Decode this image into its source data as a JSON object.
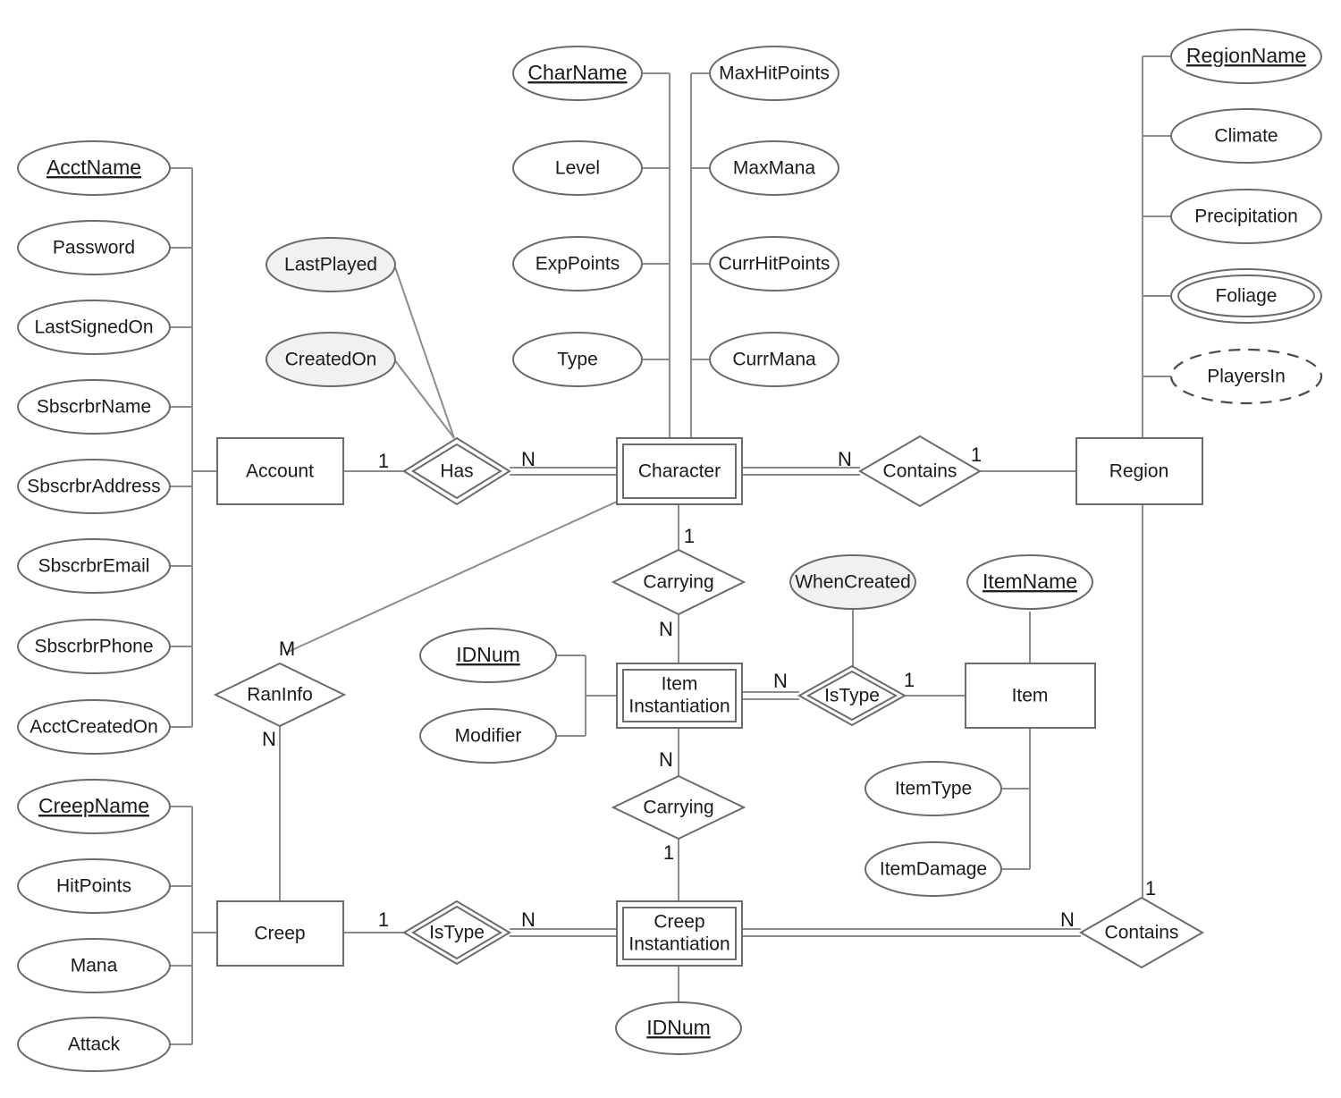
{
  "diagram": {
    "title": "ER Diagram",
    "colors": {
      "stroke": "#6b6b6b",
      "link": "#8c8c8c",
      "shaded_fill": "#f1f1f1",
      "plain_fill": "#ffffff",
      "text": "#1b1b1b"
    },
    "entities": [
      {
        "id": "account",
        "label": "Account",
        "kind": "strong"
      },
      {
        "id": "character",
        "label": "Character",
        "kind": "weak"
      },
      {
        "id": "region",
        "label": "Region",
        "kind": "strong"
      },
      {
        "id": "item_inst",
        "label_line1": "Item",
        "label_line2": "Instantiation",
        "kind": "weak"
      },
      {
        "id": "item",
        "label": "Item",
        "kind": "strong"
      },
      {
        "id": "creep",
        "label": "Creep",
        "kind": "strong"
      },
      {
        "id": "creep_inst",
        "label_line1": "Creep",
        "label_line2": "Instantiation",
        "kind": "weak"
      }
    ],
    "relationships": [
      {
        "id": "has",
        "label": "Has",
        "kind": "identifying",
        "left_card": "1",
        "right_card": "N"
      },
      {
        "id": "contains_top",
        "label": "Contains",
        "kind": "normal",
        "left_card": "N",
        "right_card": "1"
      },
      {
        "id": "carrying_char_item",
        "label": "Carrying",
        "kind": "normal",
        "top_card": "1",
        "bottom_card": "N"
      },
      {
        "id": "istype_item",
        "label": "IsType",
        "kind": "identifying",
        "left_card": "N",
        "right_card": "1"
      },
      {
        "id": "raninfo",
        "label": "RanInfo",
        "kind": "normal",
        "top_card": "M",
        "bottom_card": "N"
      },
      {
        "id": "carrying_item_creep",
        "label": "Carrying",
        "kind": "normal",
        "top_card": "N",
        "bottom_card": "1"
      },
      {
        "id": "istype_creep",
        "label": "IsType",
        "kind": "identifying",
        "left_card": "1",
        "right_card": "N"
      },
      {
        "id": "contains_bottom",
        "label": "Contains",
        "kind": "normal",
        "left_card": "N",
        "top_card": "1"
      }
    ],
    "attributes": {
      "account": [
        {
          "label": "AcctName",
          "kind": "key"
        },
        {
          "label": "Password",
          "kind": "simple"
        },
        {
          "label": "LastSignedOn",
          "kind": "simple"
        },
        {
          "label": "SbscrbrName",
          "kind": "simple"
        },
        {
          "label": "SbscrbrAddress",
          "kind": "simple"
        },
        {
          "label": "SbscrbrEmail",
          "kind": "simple"
        },
        {
          "label": "SbscrbrPhone",
          "kind": "simple"
        },
        {
          "label": "AcctCreatedOn",
          "kind": "simple"
        }
      ],
      "has": [
        {
          "label": "LastPlayed",
          "kind": "shaded"
        },
        {
          "label": "CreatedOn",
          "kind": "shaded"
        }
      ],
      "character_left": [
        {
          "label": "CharName",
          "kind": "key"
        },
        {
          "label": "Level",
          "kind": "simple"
        },
        {
          "label": "ExpPoints",
          "kind": "simple"
        },
        {
          "label": "Type",
          "kind": "simple"
        }
      ],
      "character_right": [
        {
          "label": "MaxHitPoints",
          "kind": "simple"
        },
        {
          "label": "MaxMana",
          "kind": "simple"
        },
        {
          "label": "CurrHitPoints",
          "kind": "simple"
        },
        {
          "label": "CurrMana",
          "kind": "simple"
        }
      ],
      "region": [
        {
          "label": "RegionName",
          "kind": "key"
        },
        {
          "label": "Climate",
          "kind": "simple"
        },
        {
          "label": "Precipitation",
          "kind": "simple"
        },
        {
          "label": "Foliage",
          "kind": "multivalued"
        },
        {
          "label": "PlayersIn",
          "kind": "derived"
        }
      ],
      "item_inst": [
        {
          "label": "IDNum",
          "kind": "key"
        },
        {
          "label": "Modifier",
          "kind": "simple"
        }
      ],
      "istype_item": [
        {
          "label": "WhenCreated",
          "kind": "shaded"
        }
      ],
      "item": [
        {
          "label": "ItemName",
          "kind": "key"
        },
        {
          "label": "ItemType",
          "kind": "simple"
        },
        {
          "label": "ItemDamage",
          "kind": "simple"
        }
      ],
      "creep": [
        {
          "label": "CreepName",
          "kind": "key"
        },
        {
          "label": "HitPoints",
          "kind": "simple"
        },
        {
          "label": "Mana",
          "kind": "simple"
        },
        {
          "label": "Attack",
          "kind": "simple"
        }
      ],
      "creep_inst": [
        {
          "label": "IDNum",
          "kind": "key"
        }
      ]
    },
    "cardinality_labels": [
      {
        "id": "account-has",
        "text": "1"
      },
      {
        "id": "has-character",
        "text": "N"
      },
      {
        "id": "character-contains",
        "text": "N"
      },
      {
        "id": "contains-region",
        "text": "1"
      },
      {
        "id": "character-carrying",
        "text": "1"
      },
      {
        "id": "carrying-iteminst",
        "text": "N"
      },
      {
        "id": "iteminst-istype",
        "text": "N"
      },
      {
        "id": "istype-item",
        "text": "1"
      },
      {
        "id": "character-raninfo",
        "text": "M"
      },
      {
        "id": "raninfo-creep",
        "text": "N"
      },
      {
        "id": "iteminst-carrying2",
        "text": "N"
      },
      {
        "id": "carrying2-creepinst",
        "text": "1"
      },
      {
        "id": "creep-istype2",
        "text": "1"
      },
      {
        "id": "istype2-creepinst",
        "text": "N"
      },
      {
        "id": "creepinst-contains2",
        "text": "N"
      },
      {
        "id": "contains2-region",
        "text": "1"
      }
    ]
  }
}
